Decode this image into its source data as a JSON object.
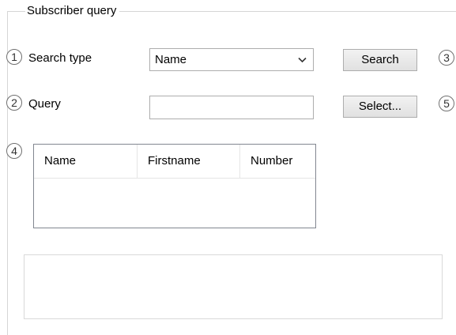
{
  "group": {
    "title": "Subscriber query"
  },
  "badges": [
    "1",
    "2",
    "3",
    "4",
    "5"
  ],
  "search_type": {
    "label": "Search type",
    "selected": "Name",
    "icon": "chevron-down-icon"
  },
  "query": {
    "label": "Query",
    "value": "",
    "placeholder": ""
  },
  "buttons": {
    "search": "Search",
    "select": "Select..."
  },
  "results_table": {
    "columns": [
      "Name",
      "Firstname",
      "Number"
    ],
    "rows": []
  }
}
